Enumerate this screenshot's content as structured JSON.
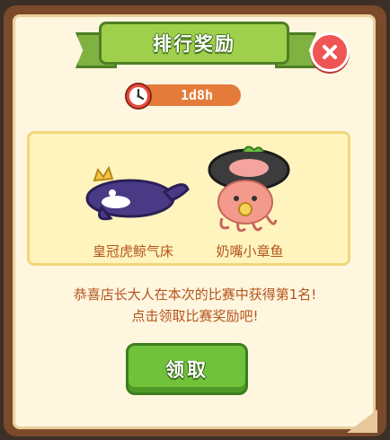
{
  "dialog": {
    "title": "排行奖励",
    "close_icon": "close-icon",
    "timer": {
      "icon": "clock-icon",
      "value": "1d8h"
    },
    "prizes": [
      {
        "name": "皇冠虎鲸气床",
        "icon": "crown-orca-float-icon"
      },
      {
        "name": "奶嘴小章鱼",
        "icon": "pacifier-octopus-icon"
      }
    ],
    "message_line1": "恭喜店长大人在本次的比赛中获得第1名!",
    "message_line2": "点击领取比赛奖励吧!",
    "claim_label": "领取"
  },
  "colors": {
    "ribbon": "#9ed04c",
    "close_button": "#f05555",
    "timer_bar": "#e57b3b",
    "claim_button": "#6fc23a",
    "text": "#b4541e"
  }
}
